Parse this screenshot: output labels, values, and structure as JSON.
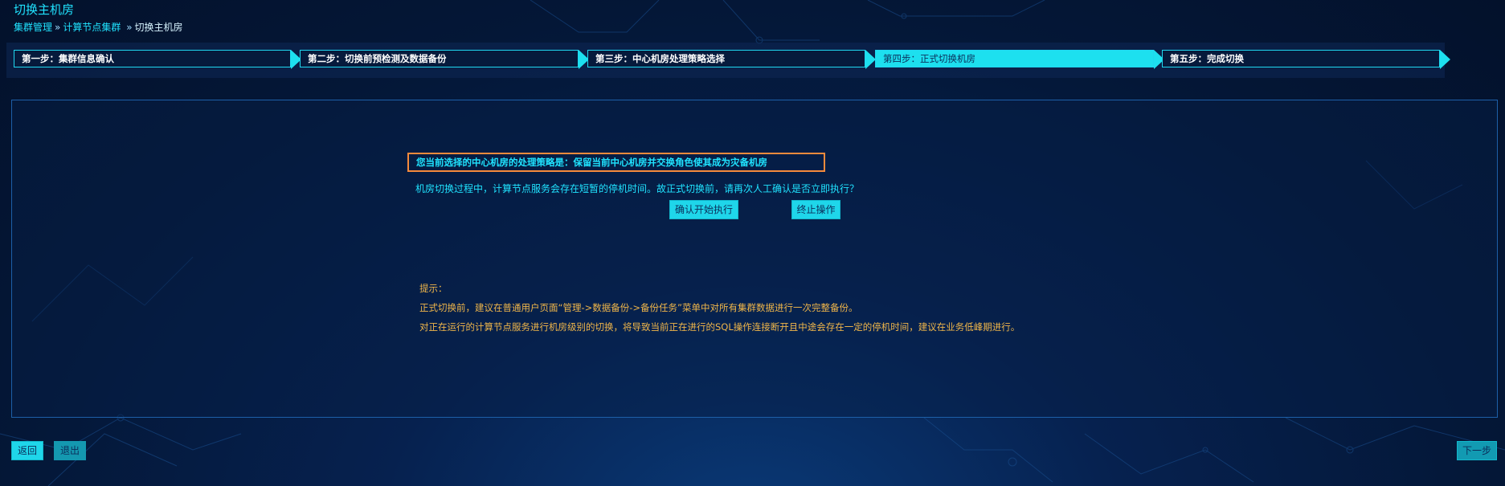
{
  "header": {
    "title": "切换主机房",
    "breadcrumb": {
      "level1": "集群管理",
      "sep": "»",
      "level2": "计算节点集群",
      "current": "切换主机房"
    }
  },
  "steps": [
    {
      "label": "第一步：集群信息确认",
      "active": false
    },
    {
      "label": "第二步：切换前预检测及数据备份",
      "active": false
    },
    {
      "label": "第三步：中心机房处理策略选择",
      "active": false
    },
    {
      "label": "第四步：正式切换机房",
      "active": true
    },
    {
      "label": "第五步：完成切换",
      "active": false
    }
  ],
  "main": {
    "strategy_text": "您当前选择的中心机房的处理策略是：保留当前中心机房并交换角色使其成为灾备机房",
    "confirm_text": "机房切换过程中，计算节点服务会存在短暂的停机时间。故正式切换前，请再次人工确认是否立即执行？",
    "confirm_button": "确认开始执行",
    "abort_button": "终止操作",
    "tips_title": "提示：",
    "tip1": "正式切换前，建议在普通用户页面“管理->数据备份->备份任务”菜单中对所有集群数据进行一次完整备份。",
    "tip2": "对正在运行的计算节点服务进行机房级别的切换，将导致当前正在进行的SQL操作连接断开且中途会存在一定的停机时间，建议在业务低峰期进行。"
  },
  "footer": {
    "back_button": "返回",
    "exit_button": "退出",
    "next_button": "下一步"
  },
  "colors": {
    "accent": "#1de0ef",
    "highlight_border": "#f58a3c",
    "tip_text": "#f0b64a"
  }
}
